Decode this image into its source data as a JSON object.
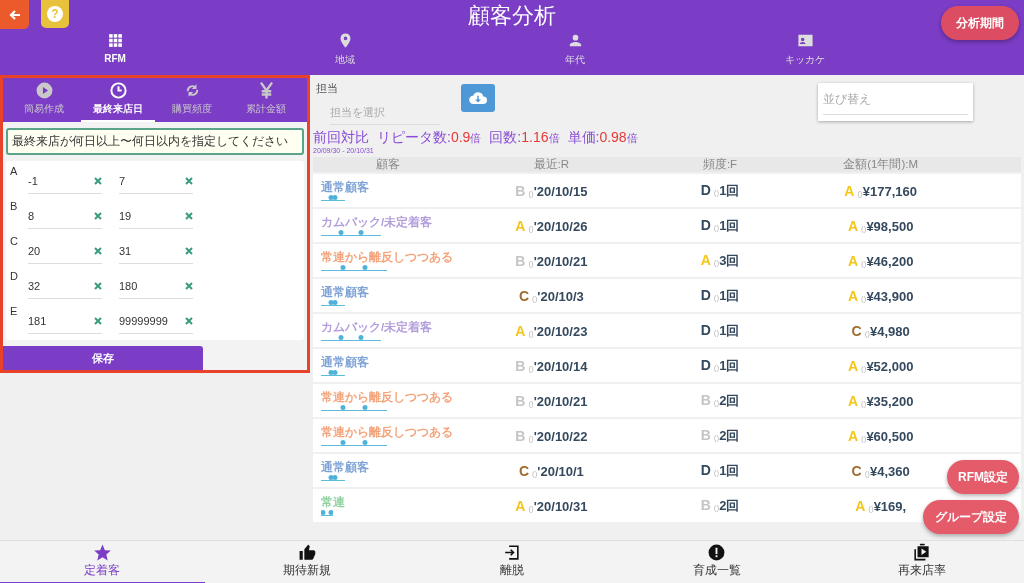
{
  "header": {
    "title": "顧客分析",
    "help_label": "?",
    "period_button": "分析期間"
  },
  "nav_tabs": [
    {
      "label": "RFM",
      "selected": true
    },
    {
      "label": "地域",
      "selected": false
    },
    {
      "label": "年代",
      "selected": false
    },
    {
      "label": "キッカケ",
      "selected": false
    }
  ],
  "rfm_panel": {
    "tabs": [
      {
        "label": "簡易作成",
        "selected": false
      },
      {
        "label": "最終来店日",
        "selected": true
      },
      {
        "label": "購買頻度",
        "selected": false
      },
      {
        "label": "累計金額",
        "selected": false
      }
    ],
    "instruction": "最終来店が何日以上〜何日以内を指定してください",
    "ranges": [
      {
        "rank": "A",
        "from": "-1",
        "to": "7"
      },
      {
        "rank": "B",
        "from": "8",
        "to": "19"
      },
      {
        "rank": "C",
        "from": "20",
        "to": "31"
      },
      {
        "rank": "D",
        "from": "32",
        "to": "180"
      },
      {
        "rank": "E",
        "from": "181",
        "to": "99999999"
      }
    ],
    "save_button": "保存"
  },
  "filters": {
    "staff_label": "担当",
    "staff_placeholder": "担当を選択",
    "sort_placeholder": "並び替え"
  },
  "comparison": {
    "title": "前回対比",
    "period": "20/09/30 - 20/10/31",
    "metrics": [
      {
        "label": "リピータ数:",
        "value": "0.9",
        "unit": "倍"
      },
      {
        "label": "回数:",
        "value": "1.16",
        "unit": "倍"
      },
      {
        "label": "単価:",
        "value": "0.98",
        "unit": "倍"
      }
    ]
  },
  "table": {
    "columns": [
      "顧客",
      "最近:R",
      "頻度:F",
      "金額(1年間):M"
    ],
    "rows": [
      {
        "tag": "通常顧客",
        "color": "#7fa3d6",
        "recency": {
          "grade": "B",
          "color": "#c4c4c4",
          "note": "()",
          "value": "'20/10/15"
        },
        "frequency": {
          "grade": "D",
          "color": "#34495e",
          "note": "()",
          "value": "1回"
        },
        "monetary": {
          "grade": "A",
          "color": "#f5c518",
          "note": "()",
          "value": "¥177,160"
        }
      },
      {
        "tag": "カムバック/未定着客",
        "color": "#b39ddb",
        "recency": {
          "grade": "A",
          "color": "#f5c518",
          "note": "()",
          "value": "'20/10/26"
        },
        "frequency": {
          "grade": "D",
          "color": "#34495e",
          "note": "()",
          "value": "1回"
        },
        "monetary": {
          "grade": "A",
          "color": "#f5c518",
          "note": "()",
          "value": "¥98,500"
        }
      },
      {
        "tag": "常連から離反しつつある",
        "color": "#f4a37a",
        "recency": {
          "grade": "B",
          "color": "#c4c4c4",
          "note": "()",
          "value": "'20/10/21"
        },
        "frequency": {
          "grade": "A",
          "color": "#f5c518",
          "note": "()",
          "value": "3回"
        },
        "monetary": {
          "grade": "A",
          "color": "#f5c518",
          "note": "()",
          "value": "¥46,200"
        }
      },
      {
        "tag": "通常顧客",
        "color": "#7fa3d6",
        "recency": {
          "grade": "C",
          "color": "#a06a2c",
          "note": "()",
          "value": "'20/10/3"
        },
        "frequency": {
          "grade": "D",
          "color": "#34495e",
          "note": "()",
          "value": "1回"
        },
        "monetary": {
          "grade": "A",
          "color": "#f5c518",
          "note": "()",
          "value": "¥43,900"
        }
      },
      {
        "tag": "カムバック/未定着客",
        "color": "#b39ddb",
        "recency": {
          "grade": "A",
          "color": "#f5c518",
          "note": "()",
          "value": "'20/10/23"
        },
        "frequency": {
          "grade": "D",
          "color": "#34495e",
          "note": "()",
          "value": "1回"
        },
        "monetary": {
          "grade": "C",
          "color": "#a06a2c",
          "note": "()",
          "value": "¥4,980"
        }
      },
      {
        "tag": "通常顧客",
        "color": "#7fa3d6",
        "recency": {
          "grade": "B",
          "color": "#c4c4c4",
          "note": "()",
          "value": "'20/10/14"
        },
        "frequency": {
          "grade": "D",
          "color": "#34495e",
          "note": "()",
          "value": "1回"
        },
        "monetary": {
          "grade": "A",
          "color": "#f5c518",
          "note": "()",
          "value": "¥52,000"
        }
      },
      {
        "tag": "常連から離反しつつある",
        "color": "#f4a37a",
        "recency": {
          "grade": "B",
          "color": "#c4c4c4",
          "note": "()",
          "value": "'20/10/21"
        },
        "frequency": {
          "grade": "B",
          "color": "#c4c4c4",
          "note": "()",
          "value": "2回"
        },
        "monetary": {
          "grade": "A",
          "color": "#f5c518",
          "note": "()",
          "value": "¥35,200"
        }
      },
      {
        "tag": "常連から離反しつつある",
        "color": "#f4a37a",
        "recency": {
          "grade": "B",
          "color": "#c4c4c4",
          "note": "()",
          "value": "'20/10/22"
        },
        "frequency": {
          "grade": "B",
          "color": "#c4c4c4",
          "note": "()",
          "value": "2回"
        },
        "monetary": {
          "grade": "A",
          "color": "#f5c518",
          "note": "()",
          "value": "¥60,500"
        }
      },
      {
        "tag": "通常顧客",
        "color": "#7fa3d6",
        "recency": {
          "grade": "C",
          "color": "#a06a2c",
          "note": "()",
          "value": "'20/10/1"
        },
        "frequency": {
          "grade": "D",
          "color": "#34495e",
          "note": "()",
          "value": "1回"
        },
        "monetary": {
          "grade": "C",
          "color": "#a06a2c",
          "note": "()",
          "value": "¥4,360"
        }
      },
      {
        "tag": "常連",
        "color": "#8fd19e",
        "recency": {
          "grade": "A",
          "color": "#f5c518",
          "note": "()",
          "value": "'20/10/31"
        },
        "frequency": {
          "grade": "B",
          "color": "#c4c4c4",
          "note": "()",
          "value": "2回"
        },
        "monetary": {
          "grade": "A",
          "color": "#f5c518",
          "note": "()",
          "value": "¥169,"
        }
      }
    ]
  },
  "fabs": [
    "RFM設定",
    "グループ設定"
  ],
  "bottom_nav": [
    {
      "label": "定着客",
      "selected": true
    },
    {
      "label": "期待新規",
      "selected": false
    },
    {
      "label": "離脱",
      "selected": false
    },
    {
      "label": "育成一覧",
      "selected": false
    },
    {
      "label": "再来店率",
      "selected": false
    }
  ]
}
